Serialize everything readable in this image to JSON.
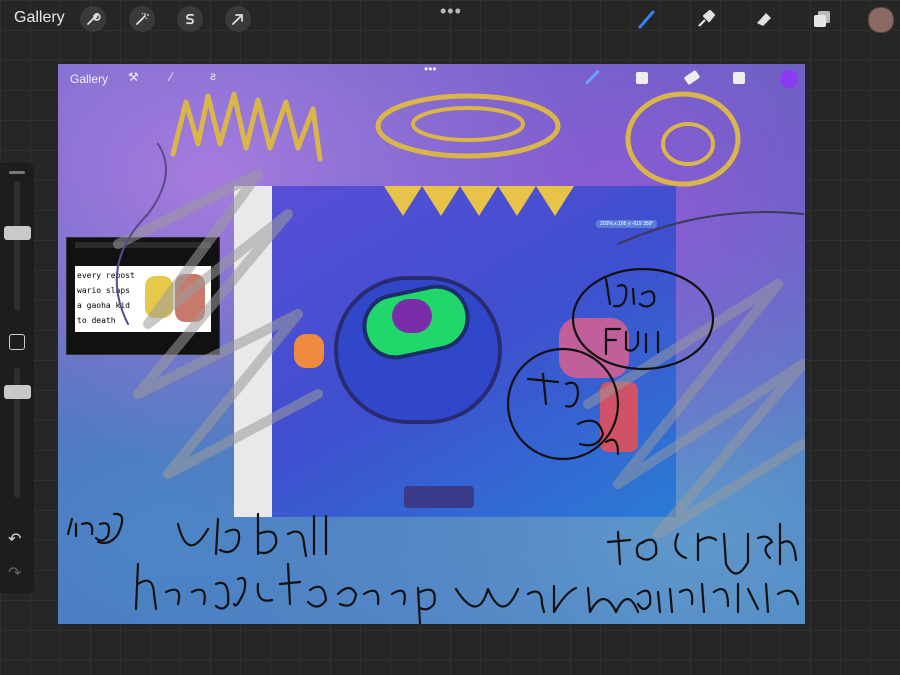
{
  "app": {
    "gallery_label": "Gallery"
  },
  "toolbar_left": [
    "wrench-icon",
    "magic-wand-icon",
    "selection-s-icon",
    "transform-arrow-icon"
  ],
  "toolbar_right": [
    "brush-icon",
    "smudge-icon",
    "eraser-icon",
    "layers-icon"
  ],
  "colors": {
    "accent": "#3b82f6",
    "current_color": "#8a6a62"
  },
  "canvas": {
    "gallery_label": "Gallery",
    "zoom_readout": "203% x:166 y:-619 359°",
    "meme_lines": [
      "every repost",
      "wario slaps",
      "a gaoha kid",
      "to death"
    ]
  }
}
